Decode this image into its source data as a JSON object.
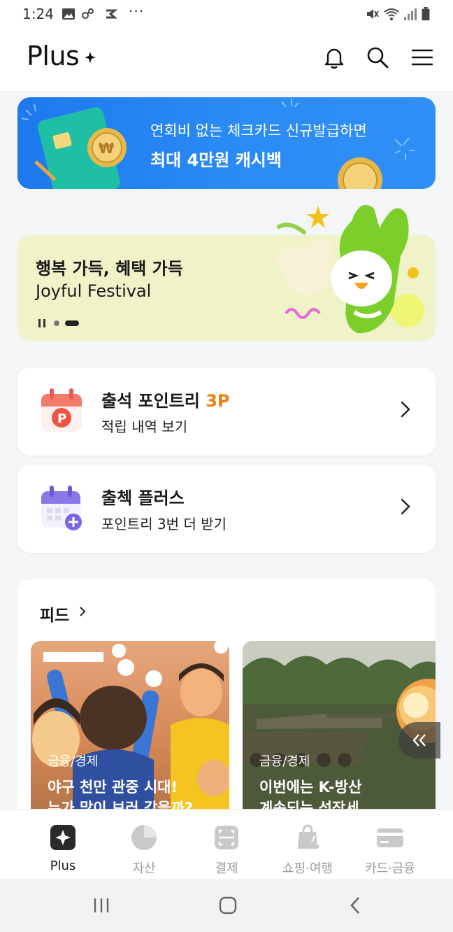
{
  "status": {
    "time": "1:24",
    "dots": "···"
  },
  "header": {
    "title": "Plus"
  },
  "promo": {
    "line1": "연회비 없는 체크카드 신규발급하면",
    "line2": "최대 4만원 캐시백"
  },
  "festival": {
    "title": "행복 가득, 혜택 가득",
    "subtitle": "Joyful Festival"
  },
  "cards": [
    {
      "title": "출석 포인트리",
      "accent": "3P",
      "subtitle": "적립 내역 보기"
    },
    {
      "title": "출첵 플러스",
      "subtitle": "포인트리 3번 더 받기"
    }
  ],
  "feed": {
    "heading": "피드",
    "items": [
      {
        "category": "금융/경제",
        "title": "야구 천만 관중 시대!",
        "title2": "누가 많이 보러 갔을까?"
      },
      {
        "category": "금융/경제",
        "title": "이번에는 K-방산",
        "title2": "계속되는 성장세"
      }
    ]
  },
  "bottom_nav": [
    {
      "label": "Plus",
      "active": true
    },
    {
      "label": "자산"
    },
    {
      "label": "결제"
    },
    {
      "label": "쇼핑·여행"
    },
    {
      "label": "카드·금융"
    }
  ],
  "colors": {
    "accent": "#ef7d14",
    "banner_blue": "#2c8cf5",
    "festival_bg": "#f0f2c8"
  }
}
